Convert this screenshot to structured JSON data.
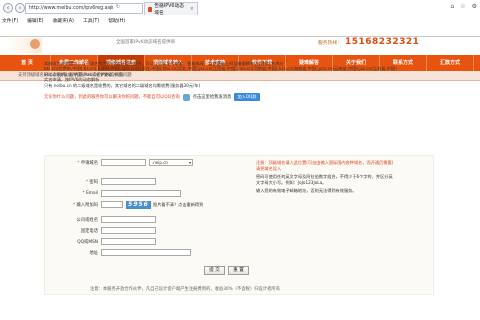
{
  "browser": {
    "url": "http://www.meibu.com/ipv6reg.asp",
    "tab_title": "告循IPV6动态域名",
    "menu": [
      "文件(F)",
      "编辑(E)",
      "收藏夹(A)",
      "工具(T)",
      "帮助(H)"
    ]
  },
  "header": {
    "slogan": "全国首家IPv6动态域名提供商",
    "hotline_label": "服务热线：",
    "phone": "15168232321"
  },
  "nav": {
    "items": [
      "首 页",
      "免费二级域名",
      "顶级域名注册",
      "顶级域名转入",
      "技术支持",
      "软件下载",
      "疑难解答",
      "关于我们",
      "联系方式",
      "汇款方式"
    ]
  },
  "subbar_text": "支持顶级域名的动态解析，解析到IPV4或者IPV6均没有问题",
  "intro": {
    "lines": [
      "本服务为收费服务，以下域名专为IPV6地址用户提供，可以让您家里的电脑、智能电视、监控摄像上网设备都拥有固定的域名地址",
      "bts.cn(北京市,中国),tjs.cn(天津市,中国),sjzs.cn(石家庄,中国),hbs.cn(河北,中国),jxs.cn(江西省,中国),hns.cn(河南省,中国),hzs.cn(海南省,中国),yns.cn(云南省,中国),jss.cn(江苏省,中国)",
      "ahs.cn(安徽省,中国),nxs.cn(宁夏省,中国)",
      "实名申请，按IPV6的动态解析",
      "只有 neibu.cn 的二级域名是收费的，其它域名的二级域名均需收费(服务器30元/年)"
    ],
    "notice": "无论你什么问题，到此的服务你可以解决你的问题，不能自可以QQ咨询",
    "qq_text": "点击这里给我发消息",
    "qq_button": "加入QQ群"
  },
  "form": {
    "fields": [
      {
        "label": "申请域名",
        "required": true,
        "value": "",
        "suffix": ".neip.cn"
      },
      {
        "label": "密码",
        "required": true,
        "value": ""
      },
      {
        "label": "Email",
        "required": true,
        "value": ""
      },
      {
        "label": "输入附加码",
        "required": true,
        "value": ""
      },
      {
        "label": "公司或姓名",
        "required": false,
        "value": ""
      },
      {
        "label": "固定电话",
        "required": false,
        "value": ""
      },
      {
        "label": "QQ或MSN",
        "required": false,
        "value": ""
      },
      {
        "label": "地址",
        "required": false,
        "value": ""
      }
    ],
    "captcha_code": "5956",
    "captcha_hint": "图片看不清？点击重新得到",
    "side_note": {
      "red": "注册：顶级域名请入此位置(可自由输入国际国内各种域名，而开通后需要)请把域名设入",
      "line2": "密码可使用任何英文字母及阿拉伯数字组合，不得少于6个字符，并区分英文字母大小写。例如：JoJo123JoLa。",
      "line3": "输入您的有效电子邮箱地址，否则无法得到有效服务。"
    },
    "submit_label": "提 交",
    "reset_label": "重 置"
  },
  "footer_note": "注意：本服务开放合作伙伴，凡自己设计客户端产生注册费用的，收益30%（不含税）归设计者所有"
}
